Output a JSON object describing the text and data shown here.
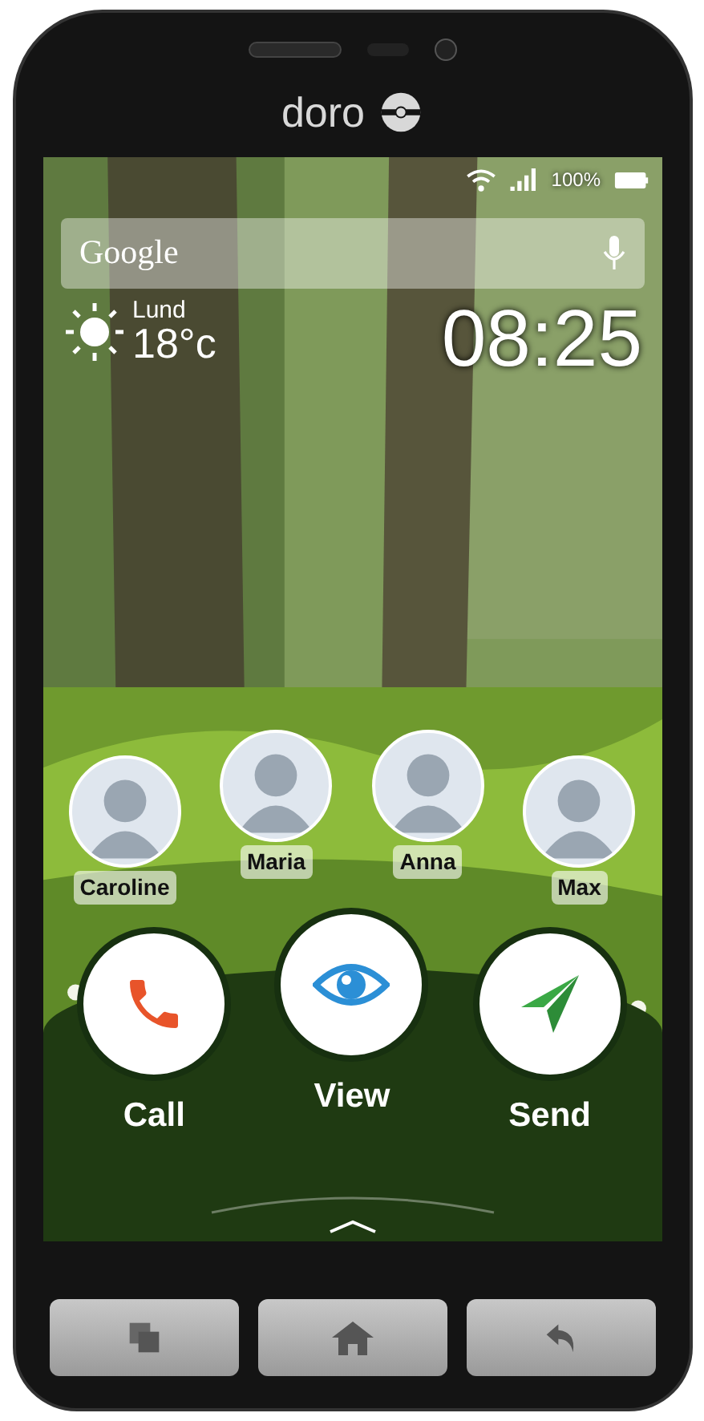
{
  "brand": {
    "logo": "doro"
  },
  "status_bar": {
    "battery": "100%"
  },
  "search": {
    "label": "Google"
  },
  "weather": {
    "city": "Lund",
    "temperature": "18°c"
  },
  "clock": {
    "time": "08:25"
  },
  "contacts": [
    {
      "name": "Caroline"
    },
    {
      "name": "Maria"
    },
    {
      "name": "Anna"
    },
    {
      "name": "Max"
    }
  ],
  "actions": [
    {
      "kind": "call",
      "label": "Call"
    },
    {
      "kind": "view",
      "label": "View"
    },
    {
      "kind": "send",
      "label": "Send"
    }
  ]
}
